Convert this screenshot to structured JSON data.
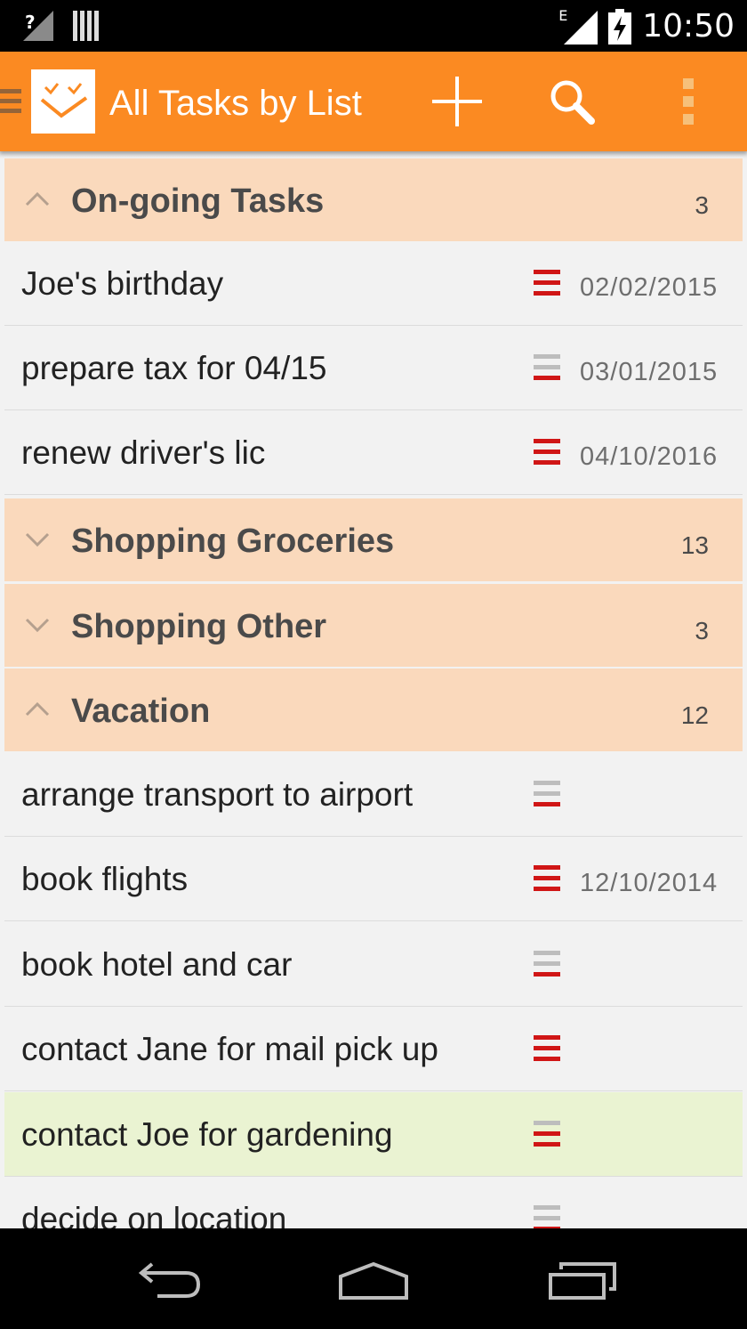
{
  "status_bar": {
    "time": "10:50",
    "network_type": "E",
    "icons": [
      "signal-unknown-icon",
      "sim-bars-icon",
      "signal-icon",
      "battery-charging-icon"
    ]
  },
  "action_bar": {
    "title": "All Tasks by List",
    "icons": [
      "drawer-icon",
      "app-logo-icon",
      "add-icon",
      "search-icon",
      "overflow-menu-icon"
    ],
    "accent_color": "#fb8a22"
  },
  "colors": {
    "group_header_bg": "#fad9bc",
    "row_bg": "#f2f2f2",
    "highlight_row_bg": "#eaf3d2",
    "priority_high": "#d01616",
    "priority_medium_top": "#bdbdbd"
  },
  "groups": [
    {
      "name": "On-going Tasks",
      "count": "3",
      "expanded": true
    },
    {
      "name": "Shopping Groceries",
      "count": "13",
      "expanded": false
    },
    {
      "name": "Shopping Other",
      "count": "3",
      "expanded": false
    },
    {
      "name": "Vacation",
      "count": "12",
      "expanded": true
    }
  ],
  "tasks": [
    {
      "name": "Joe's birthday",
      "date": "02/02/2015",
      "priority": "high"
    },
    {
      "name": "prepare tax for 04/15",
      "date": "03/01/2015",
      "priority": "low"
    },
    {
      "name": "renew driver's lic",
      "date": "04/10/2016",
      "priority": "high"
    },
    {
      "name": "arrange transport to airport",
      "date": "",
      "priority": "low"
    },
    {
      "name": "book flights",
      "date": "12/10/2014",
      "priority": "high"
    },
    {
      "name": "book hotel and car",
      "date": "",
      "priority": "low"
    },
    {
      "name": "contact Jane for mail pick up",
      "date": "",
      "priority": "high"
    },
    {
      "name": "contact Joe for gardening",
      "date": "",
      "priority": "medium",
      "highlighted": true
    },
    {
      "name": "decide on location",
      "date": "",
      "priority": "low"
    }
  ],
  "nav_bar": {
    "icons": [
      "back-icon",
      "home-icon",
      "recent-apps-icon"
    ]
  }
}
